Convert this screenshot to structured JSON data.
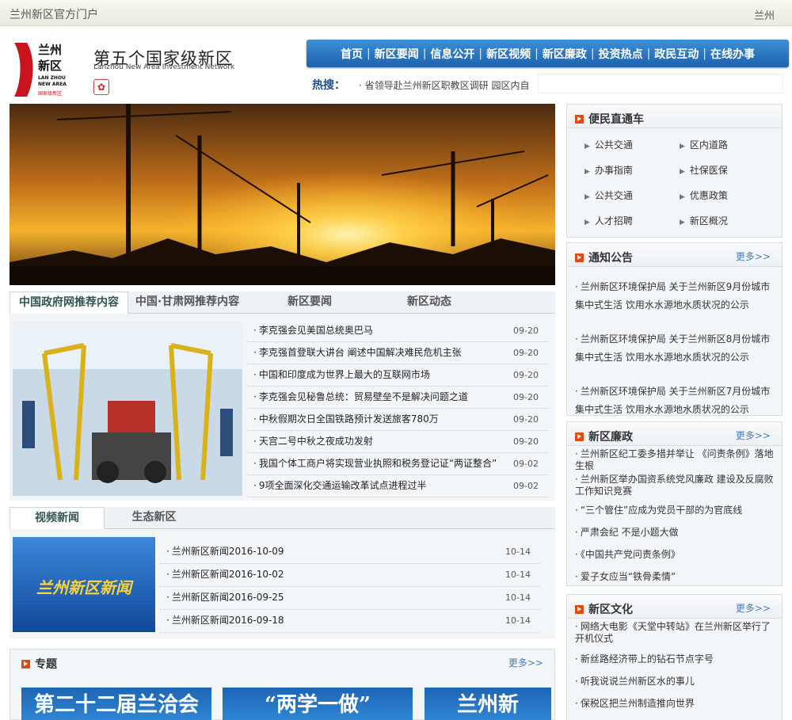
{
  "topbar": {
    "site_name": "兰州新区官方门户",
    "city": "兰州"
  },
  "logo": {
    "cn_line1": "兰州",
    "cn_line2": "新区",
    "en_line1": "LAN ZHOU",
    "en_line2": "NEW AREA",
    "tag": "国家级新区",
    "slogan": "第五个国家级新区",
    "slogan_en": "Lanzhou New Area Investment Network",
    "seal_glyph": "✿"
  },
  "nav": {
    "items": [
      "首页",
      "新区要闻",
      "信息公开",
      "新区视频",
      "新区廉政",
      "投资热点",
      "政民互动",
      "在线办事"
    ],
    "separator": "|"
  },
  "hot": {
    "label": "热搜：",
    "text": "· 省领导赴兰州新区职教区调研  园区内自"
  },
  "news_tabs": [
    "中国政府网推荐内容",
    "中国·甘肃网推荐内容",
    "新区要闻",
    "新区动态"
  ],
  "news": [
    {
      "title": "李克强会见美国总统奥巴马",
      "date": "09-20"
    },
    {
      "title": "李克强首登联大讲台 阐述中国解决难民危机主张",
      "date": "09-20"
    },
    {
      "title": "中国和印度成为世界上最大的互联网市场",
      "date": "09-20"
    },
    {
      "title": "李克强会见秘鲁总统：贸易壁垒不是解决问题之道",
      "date": "09-20"
    },
    {
      "title": "中秋假期次日全国铁路预计发送旅客780万",
      "date": "09-20"
    },
    {
      "title": "天宫二号中秋之夜成功发射",
      "date": "09-20"
    },
    {
      "title": "我国个体工商户将实现营业执照和税务登记证“两证整合”",
      "date": "09-02"
    },
    {
      "title": "9项全面深化交通运输改革试点进程过半",
      "date": "09-02"
    }
  ],
  "video_tabs": [
    "视频新闻",
    "生态新区"
  ],
  "video_thumb_text": "兰州新区新闻",
  "videos": [
    {
      "title": "兰州新区新闻2016-10-09",
      "date": "10-14"
    },
    {
      "title": "兰州新区新闻2016-10-02",
      "date": "10-14"
    },
    {
      "title": "兰州新区新闻2016-09-25",
      "date": "10-14"
    },
    {
      "title": "兰州新区新闻2016-09-18",
      "date": "10-14"
    }
  ],
  "special": {
    "title": "专题",
    "more": "更多>>",
    "promos": [
      "第二十二届兰洽会",
      "“两学一做”",
      "兰州新"
    ]
  },
  "services": {
    "title": "便民直通车",
    "items": [
      "公共交通",
      "区内道路",
      "办事指南",
      "社保医保",
      "公共交通",
      "优惠政策",
      "人才招聘",
      "新区概况"
    ]
  },
  "notices": {
    "title": "通知公告",
    "more": "更多>>",
    "items": [
      "兰州新区环境保护局 关于兰州新区9月份城市集中式生活 饮用水水源地水质状况的公示",
      "兰州新区环境保护局 关于兰州新区8月份城市集中式生活 饮用水水源地水质状况的公示",
      "兰州新区环境保护局 关于兰州新区7月份城市集中式生活 饮用水水源地水质状况的公示"
    ]
  },
  "integrity": {
    "title": "新区廉政",
    "more": "更多>>",
    "items": [
      "兰州新区纪工委多措并举让 《问责条例》落地生根",
      "兰州新区举办国资系统党风廉政 建设及反腐败工作知识竞赛",
      "“三个管住”应成为党员干部的为官底线",
      "严肃会纪 不是小题大做",
      "《中国共产党问责条例》",
      "爱子女应当“铁骨柔情”"
    ]
  },
  "culture": {
    "title": "新区文化",
    "more": "更多>>",
    "items": [
      "网络大电影《天堂中转站》在兰州新区举行了开机仪式",
      "新丝路经济带上的钻石节点字号",
      "听我说说兰州新区水的事儿",
      "保税区把兰州制造推向世界"
    ]
  },
  "colors": {
    "nav": "#1d62ad",
    "accent": "#e04a0f",
    "logo_red": "#c8141e",
    "link": "#4a7bb7"
  }
}
